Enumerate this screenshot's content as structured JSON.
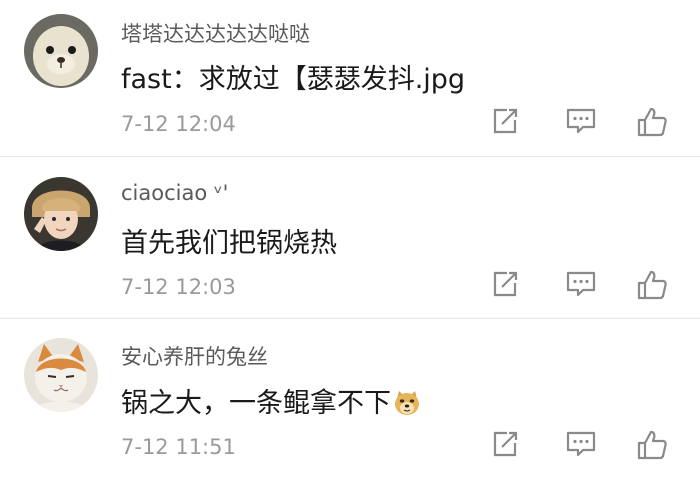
{
  "comments": [
    {
      "username": "塔塔达达达达达哒哒",
      "content": "fast：求放过【瑟瑟发抖.jpg",
      "time": "7-12 12:04",
      "avatar_icon": "seal-avatar"
    },
    {
      "username": "ciaociao ᵛ'",
      "content": "首先我们把锅烧热",
      "time": "7-12 12:03",
      "avatar_icon": "person-avatar"
    },
    {
      "username": "安心养肝的兔丝",
      "content": "锅之大，一条鲲拿不下",
      "time": "7-12 11:51",
      "avatar_icon": "cat-avatar",
      "emoji": "doge-emoji-icon"
    }
  ],
  "action_icons": [
    "share-icon",
    "comment-icon",
    "like-icon"
  ],
  "colors": {
    "username": "#5a5a5a",
    "content": "#1a1a1a",
    "time": "#9a9a9a",
    "icon": "#8a8a8a",
    "divider": "#e6e6e6"
  }
}
